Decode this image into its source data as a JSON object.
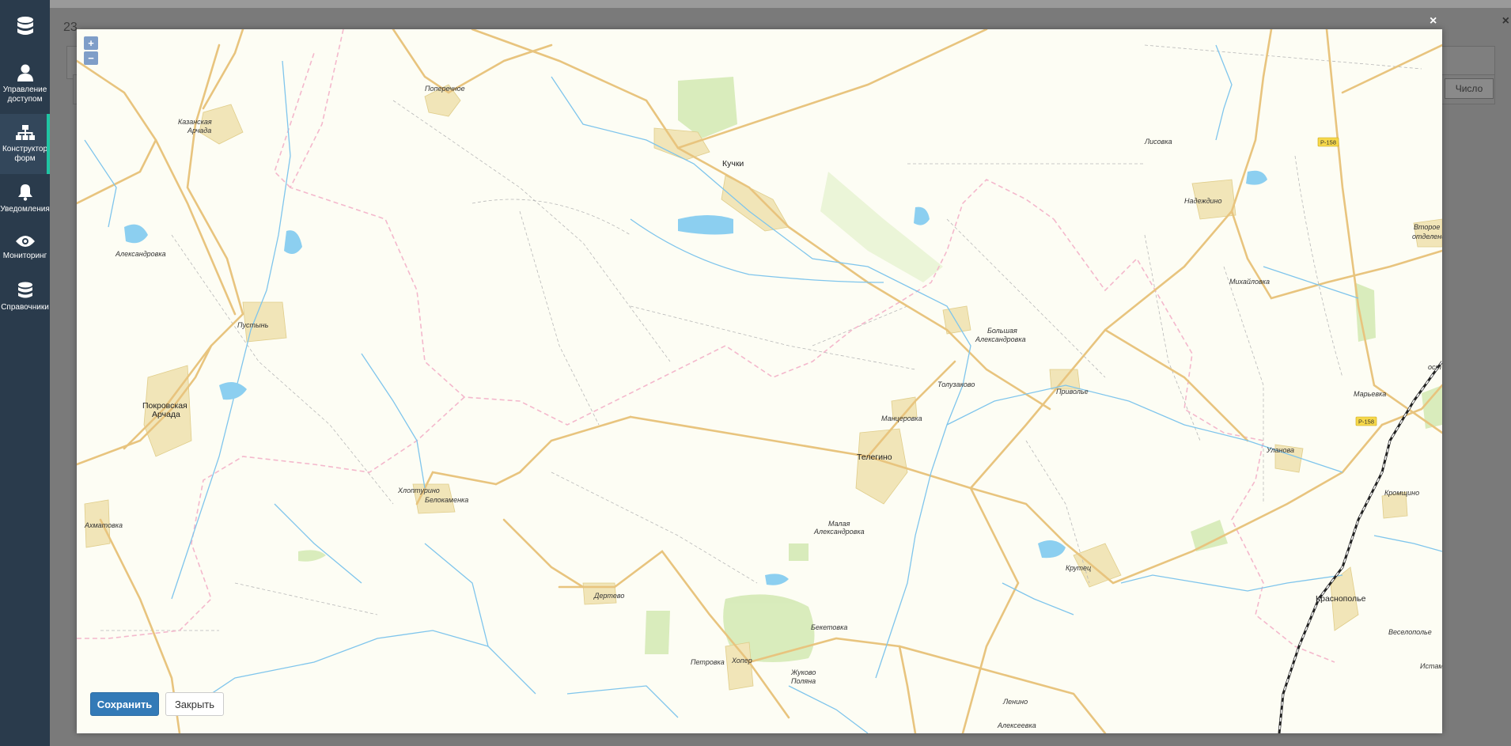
{
  "sidebar": {
    "items": [
      {
        "label": "Управление доступом",
        "icon": "user-icon"
      },
      {
        "label": "Конструктор форм",
        "icon": "sitemap-icon"
      },
      {
        "label": "Уведомления",
        "icon": "bell-icon"
      },
      {
        "label": "Мониторинг",
        "icon": "eye-icon"
      },
      {
        "label": "Справочники",
        "icon": "database-icon"
      }
    ]
  },
  "background": {
    "number": "23",
    "close": "×",
    "chislo": "Число"
  },
  "modal": {
    "close": "×",
    "zoom_in": "+",
    "zoom_out": "−",
    "save_label": "Сохранить",
    "close_label": "Закрыть"
  },
  "map": {
    "places": [
      "Поперечное",
      "Казанская",
      "Арчада",
      "Кучки",
      "Лисовка",
      "Надеждино",
      "Второе",
      "отделение",
      "Александровка",
      "Михайловка",
      "Пустынь",
      "Большая",
      "Александровка",
      "Покровская",
      "Арчада",
      "Толузаково",
      "Приволье",
      "Марьевка",
      "ост",
      "Манцеровка",
      "Телегино",
      "Уланова",
      "Хлоптурино",
      "Белокаменка",
      "Кромщино",
      "Ахматовка",
      "Малая",
      "Александровка",
      "Крутец",
      "Дертево",
      "Краснополье",
      "Бекетовка",
      "Веселополье",
      "Петровка",
      "Хопер",
      "Жуково",
      "Поляна",
      "Истам",
      "Ленино",
      "Алексеевка"
    ],
    "road_shields": [
      "Р-158",
      "Р-158"
    ]
  }
}
